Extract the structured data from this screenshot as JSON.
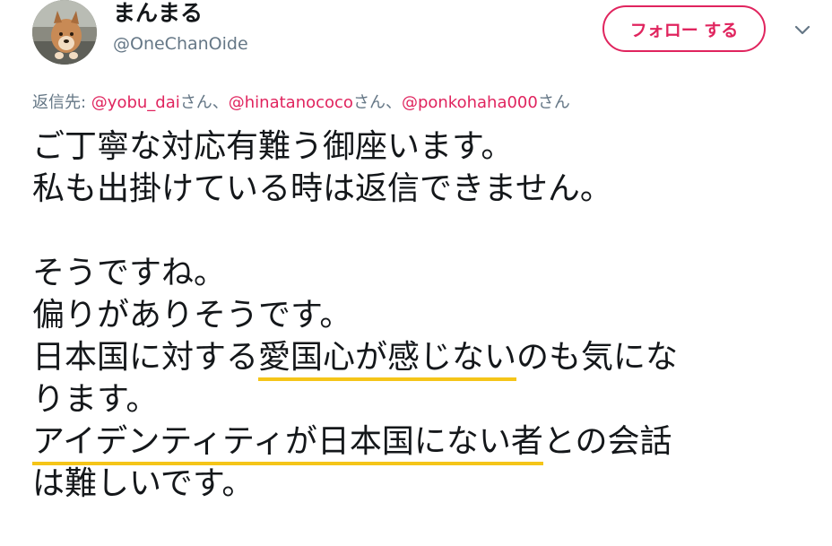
{
  "author": {
    "display_name": "まんまる",
    "screen_name": "@OneChanOide",
    "avatar_icon": "dog-avatar-icon"
  },
  "actions": {
    "follow_label": "フォロー する",
    "menu_icon": "chevron-down-icon"
  },
  "reply_context": {
    "prefix": "返信先: ",
    "mentions": [
      {
        "handle": "@yobu_dai",
        "suffix": "さん、"
      },
      {
        "handle": "@hinatanococo",
        "suffix": "さん、"
      },
      {
        "handle": "@ponkohaha000",
        "suffix": "さん"
      }
    ]
  },
  "tweet": {
    "lines": [
      "ご丁寧な対応有難う御座います。",
      "私も出掛けている時は返信できません。",
      "",
      "そうですね。",
      "偏りがありそうです。",
      "日本国に対する愛国心が感じないのも気にな",
      "ります。",
      "アイデンティティが日本国にない者との会話",
      "は難しいです。"
    ],
    "line6_parts": {
      "before": "日本国に対する",
      "marked": "愛国心が感じない",
      "after": "のも気にな"
    },
    "line8_parts": {
      "before": "",
      "marked": "アイデンティティが日本国にない者",
      "after": "との会話"
    },
    "highlight_color": "#f5c518"
  },
  "colors": {
    "accent": "#e0245e",
    "muted": "#657786",
    "text": "#14171a"
  }
}
